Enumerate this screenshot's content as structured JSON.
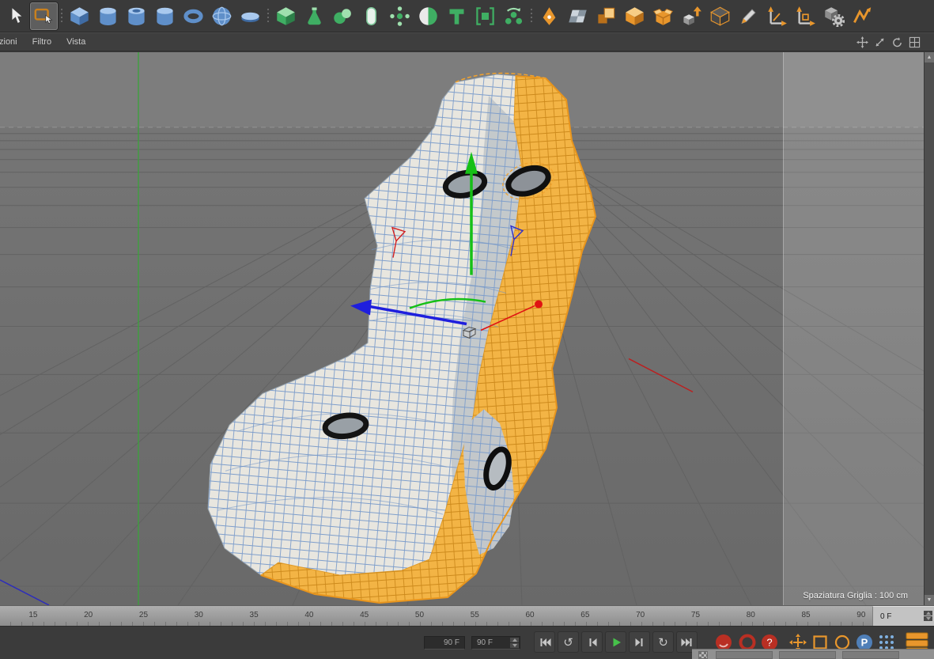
{
  "menu_bar": {
    "items": [
      "zioni",
      "Filtro",
      "Vista"
    ]
  },
  "nav_icons": [
    "pan-view",
    "zoom-view",
    "rotate-view",
    "toggle-layout"
  ],
  "toolbar_top": {
    "active_tool": "live-selection",
    "tools": [
      "selection-arrow",
      "live-selection",
      "cube-primitive",
      "cylinder-primitive",
      "tube-primitive",
      "barrel-primitive",
      "torus-primitive",
      "sphere-primitive",
      "disc-primitive",
      "extrude-generator",
      "lathe-generator",
      "metaball",
      "capsule",
      "array",
      "boole",
      "text-object",
      "instance",
      "cloner",
      "spline-pen",
      "polygon-plane",
      "extrude-poly",
      "cube-poly",
      "open-box",
      "arrow-cube",
      "wire-cube",
      "pencil",
      "axis-move",
      "axis-scale",
      "gear-cube",
      "magnet"
    ]
  },
  "viewport": {
    "grid_spacing_label": "Spaziatura Griglia : 100 cm",
    "selection_color": "#f2a93c",
    "wireframe_color": "#7e9ecb",
    "axis_colors": {
      "x": "#c42020",
      "y": "#2fa32f",
      "z": "#2d2dbb"
    }
  },
  "timeline": {
    "frame_labels": [
      "15",
      "20",
      "25",
      "30",
      "35",
      "40",
      "45",
      "50",
      "55",
      "60",
      "65",
      "70",
      "75",
      "80",
      "85",
      "90"
    ],
    "current_frame": "0 F"
  },
  "transport": {
    "loop_from": "90 F",
    "loop_to": "90 F",
    "play_backward_glyph": "↺",
    "loop_glyph": "↻",
    "buttons": [
      "goto-start",
      "play-backwards",
      "previous-frame",
      "play",
      "next-frame",
      "loop",
      "goto-end"
    ]
  },
  "record": {
    "buttons": [
      "record-keyframe",
      "autokeying",
      "record-options"
    ],
    "options_glyph": "?"
  },
  "key_toggles": {
    "buttons": [
      "record-position",
      "record-scale",
      "record-rotation",
      "record-parameter",
      "record-point-level"
    ],
    "parameter_glyph": "P"
  }
}
